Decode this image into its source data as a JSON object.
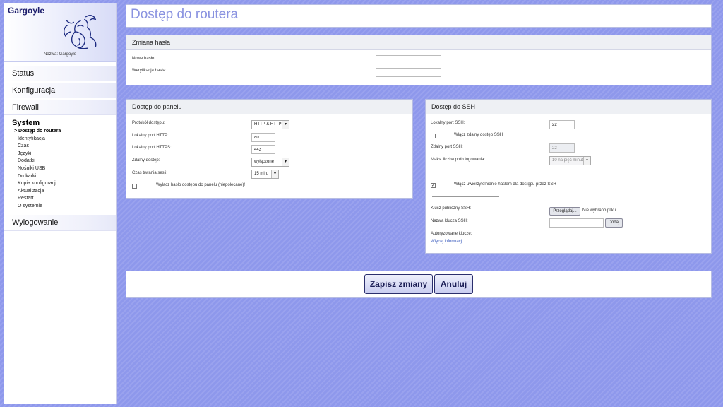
{
  "sidebar": {
    "brand_title": "Gargoyle",
    "brand_name": "Nazwa: Gargoyle",
    "top_items": [
      {
        "label": "Status"
      },
      {
        "label": "Konfiguracja"
      },
      {
        "label": "Firewall"
      }
    ],
    "active_section": "System",
    "subitems": [
      {
        "label": "> Dostęp do routera",
        "current": true
      },
      {
        "label": "Identyfikacja"
      },
      {
        "label": "Czas"
      },
      {
        "label": "Języki"
      },
      {
        "label": "Dodatki"
      },
      {
        "label": "Nośniki USB"
      },
      {
        "label": "Drukarki"
      },
      {
        "label": "Kopia konfiguracji"
      },
      {
        "label": "Aktualizacja"
      },
      {
        "label": "Restart"
      },
      {
        "label": "O systemie"
      }
    ],
    "logout": "Wylogowanie"
  },
  "page": {
    "title": "Dostęp do routera"
  },
  "password_panel": {
    "heading": "Zmiana hasła",
    "new_password_label": "Nowe hasło:",
    "verify_password_label": "Weryfikacja hasła:"
  },
  "panel_access": {
    "heading": "Dostęp do panelu",
    "protocol_label": "Protokół dostępu:",
    "protocol_value": "HTTP & HTTPS",
    "http_port_label": "Lokalny port HTTP:",
    "http_port_value": "80",
    "https_port_label": "Lokalny port HTTPS:",
    "https_port_value": "443",
    "remote_label": "Zdalny dostęp:",
    "remote_value": "wyłączone",
    "session_label": "Czas trwania sesji:",
    "session_value": "15 min.",
    "disable_password_label": "Wyłącz hasło dostępu do panelu (niepolecane)!",
    "disable_password_checked": false
  },
  "ssh": {
    "heading": "Dostęp do SSH",
    "local_port_label": "Lokalny port SSH:",
    "local_port_value": "22",
    "enable_remote_label": "Włącz zdalny dostęp SSH",
    "enable_remote_checked": false,
    "remote_port_label": "Zdalny port SSH:",
    "remote_port_value": "22",
    "max_attempts_label": "Maks. liczba prób logowania:",
    "max_attempts_value": "10 na pięć minut",
    "password_auth_label": "Włącz uwierzytelnianie hasłem dla dostępu przez SSH",
    "password_auth_checked": true,
    "public_key_label": "Klucz publiczny SSH:",
    "browse_button": "Przeglądaj...",
    "no_file": "Nie wybrano pliku.",
    "key_name_label": "Nazwa klucza SSH:",
    "key_name_value": "",
    "add_button": "Dodaj",
    "authorized_keys_label": "Autoryzowane klucze:",
    "more_info": "Więcej informacji"
  },
  "actions": {
    "save": "Zapisz zmiany",
    "cancel": "Anuluj"
  }
}
